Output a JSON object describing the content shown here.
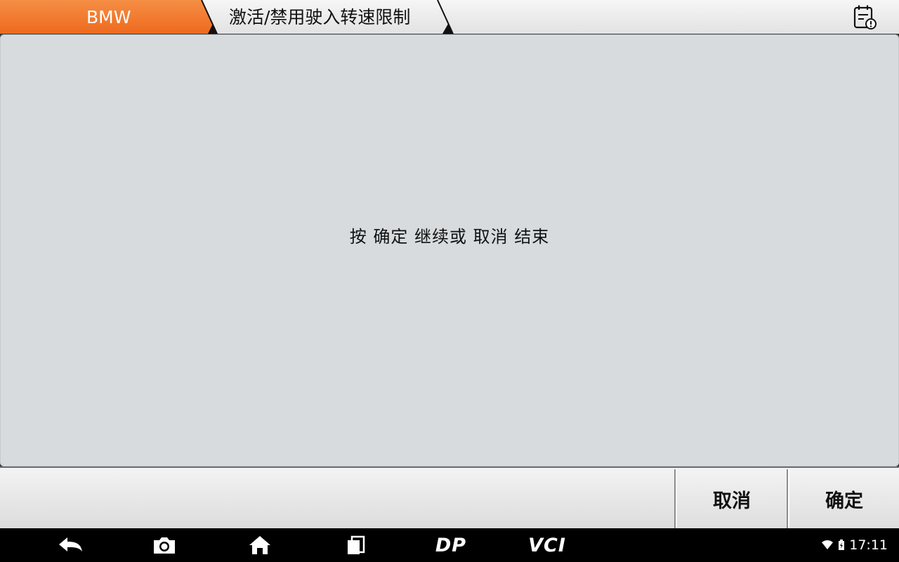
{
  "header": {
    "brand": "BMW",
    "page_title": "激活/禁用驶入转速限制",
    "report_icon": "report-icon",
    "accent_color": "#ee6a1e"
  },
  "main": {
    "prompt": "按 确定 继续或 取消 结束"
  },
  "actions": {
    "cancel_label": "取消",
    "ok_label": "确定"
  },
  "navbar": {
    "back_icon": "back-icon",
    "screenshot_icon": "camera-icon",
    "home_icon": "home-icon",
    "recents_icon": "recents-icon",
    "dp_label": "DP",
    "vci_label": "VCI"
  },
  "status_bar": {
    "time": "17:11",
    "wifi_icon": "wifi-icon",
    "battery_icon": "battery-icon"
  }
}
